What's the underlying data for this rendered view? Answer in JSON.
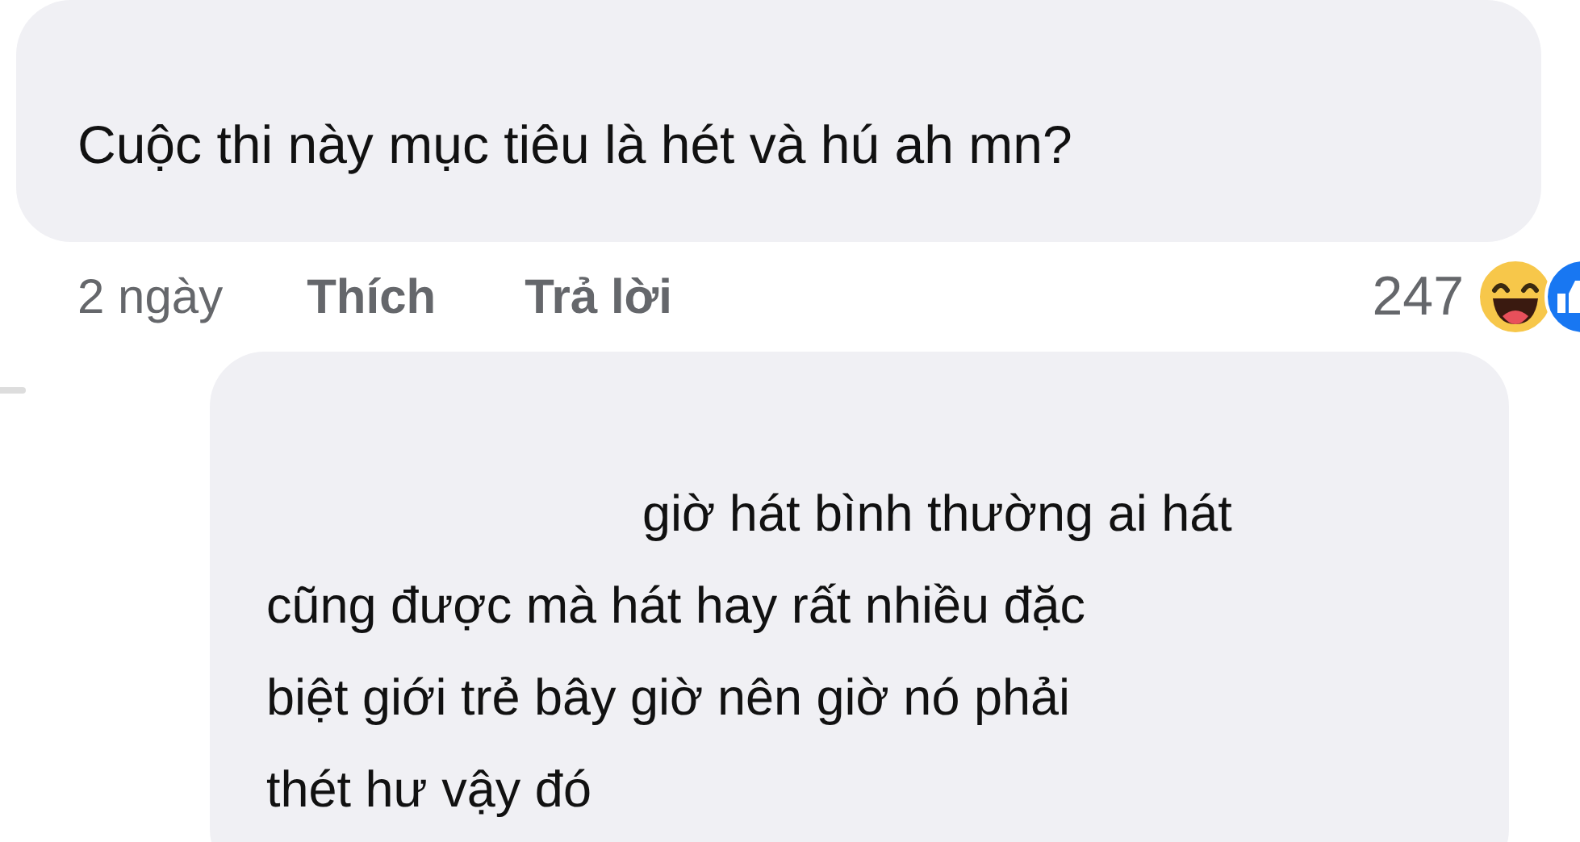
{
  "comment": {
    "text": "Cuộc thi này mục tiêu là hét và hú ah mn?"
  },
  "actions": {
    "time": "2 ngày",
    "like": "Thích",
    "reply": "Trả lời",
    "reaction_count": "247"
  },
  "reply": {
    "lines": [
      "giờ hát bình thường ai hát",
      "cũng được mà hát hay rất nhiều đặc",
      "biệt giới trẻ bây giờ nên giờ nó phải",
      "thét hư vậy đó"
    ]
  }
}
